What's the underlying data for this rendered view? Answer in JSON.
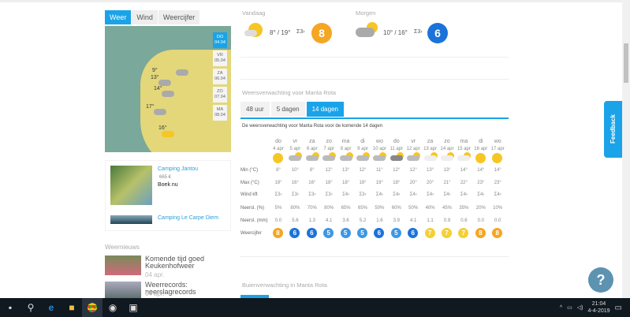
{
  "map_tabs": [
    "Weer",
    "Wind",
    "Weercijfer"
  ],
  "map_days": [
    {
      "d": "DO",
      "date": "04.04"
    },
    {
      "d": "VR",
      "date": "05.04"
    },
    {
      "d": "ZA",
      "date": "06.04"
    },
    {
      "d": "ZO",
      "date": "07.04"
    },
    {
      "d": "MA",
      "date": "08.04"
    }
  ],
  "map_temps": [
    "9°",
    "13°",
    "14°",
    "17°",
    "16°"
  ],
  "campings": [
    {
      "name": "Camping Jantou",
      "price": "665 €",
      "cta": "Boek nu"
    },
    {
      "name": "Camping Le Carpe Diem"
    }
  ],
  "news": {
    "heading": "Weernieuws",
    "items": [
      {
        "title": "Komende tijd goed Keukenhofweer",
        "date": "04 apr."
      },
      {
        "title": "Weerrecords: neerslagrecords",
        "date": "04 apr."
      }
    ]
  },
  "today": {
    "label": "Vandaag",
    "temps": "8° / 19°",
    "wind": "3",
    "rating": "8"
  },
  "tomorrow": {
    "label": "Morgen",
    "temps": "10° / 16°",
    "wind": "3",
    "rating": "6"
  },
  "forecast": {
    "title": "Weersverwachting voor Manta Rota",
    "tabs": [
      "48 uur",
      "5 dagen",
      "14 dagen"
    ],
    "subtitle": "De weersverwachting voor Manta Rota voor de komende 14 dagen",
    "days": [
      "do",
      "vr",
      "za",
      "zo",
      "ma",
      "di",
      "wo",
      "do",
      "vr",
      "za",
      "zo",
      "ma",
      "di",
      "wo"
    ],
    "dates": [
      "4 apr",
      "5 apr",
      "6 apr",
      "7 apr",
      "8 apr",
      "9 apr",
      "10 apr",
      "11 apr",
      "12 apr",
      "13 apr",
      "14 apr",
      "15 apr",
      "16 apr",
      "17 apr"
    ],
    "icons": [
      "sun",
      "rain",
      "rain",
      "rain",
      "rain",
      "rain",
      "rain",
      "heavy-rain",
      "rain",
      "partly-cloudy",
      "partly-cloudy",
      "partly-cloudy",
      "sun",
      "sun"
    ],
    "row_labels": {
      "min": "Min (°C)",
      "max": "Max (°C)",
      "wind": "Wind kft",
      "pct": "Neersl. (%)",
      "mm": "Neersl. (mm)",
      "rating": "Weercijfer"
    },
    "min": [
      "8°",
      "10°",
      "8°",
      "12°",
      "13°",
      "12°",
      "11°",
      "12°",
      "12°",
      "13°",
      "13°",
      "14°",
      "14°",
      "14°"
    ],
    "max": [
      "19°",
      "16°",
      "16°",
      "18°",
      "18°",
      "19°",
      "19°",
      "18°",
      "20°",
      "20°",
      "21°",
      "22°",
      "23°",
      "23°"
    ],
    "wind": [
      "3",
      "3",
      "3",
      "3",
      "4",
      "3",
      "4",
      "4",
      "4",
      "4",
      "4",
      "4",
      "4",
      "4"
    ],
    "pct": [
      "5%",
      "80%",
      "70%",
      "80%",
      "65%",
      "65%",
      "50%",
      "60%",
      "50%",
      "40%",
      "45%",
      "35%",
      "20%",
      "10%"
    ],
    "mm": [
      "0.0",
      "5.6",
      "1.3",
      "4.1",
      "3.6",
      "5.2",
      "1.6",
      "3.9",
      "4.1",
      "1.1",
      "0.9",
      "0.6",
      "0.0",
      "0.0"
    ],
    "rating": [
      "8",
      "6",
      "6",
      "5",
      "5",
      "5",
      "6",
      "5",
      "6",
      "7",
      "7",
      "7",
      "8",
      "8"
    ]
  },
  "buien_title": "Buienverwachting in Manta Rota",
  "feedback": "Feedback",
  "help": "?",
  "clock": {
    "time": "21:04",
    "date": "4-4-2019"
  },
  "colors": {
    "accent": "#1aa3e8",
    "r8": "#f5a623",
    "r7": "#f5d033",
    "r6": "#1a73d9",
    "r5": "#3d97e3"
  }
}
